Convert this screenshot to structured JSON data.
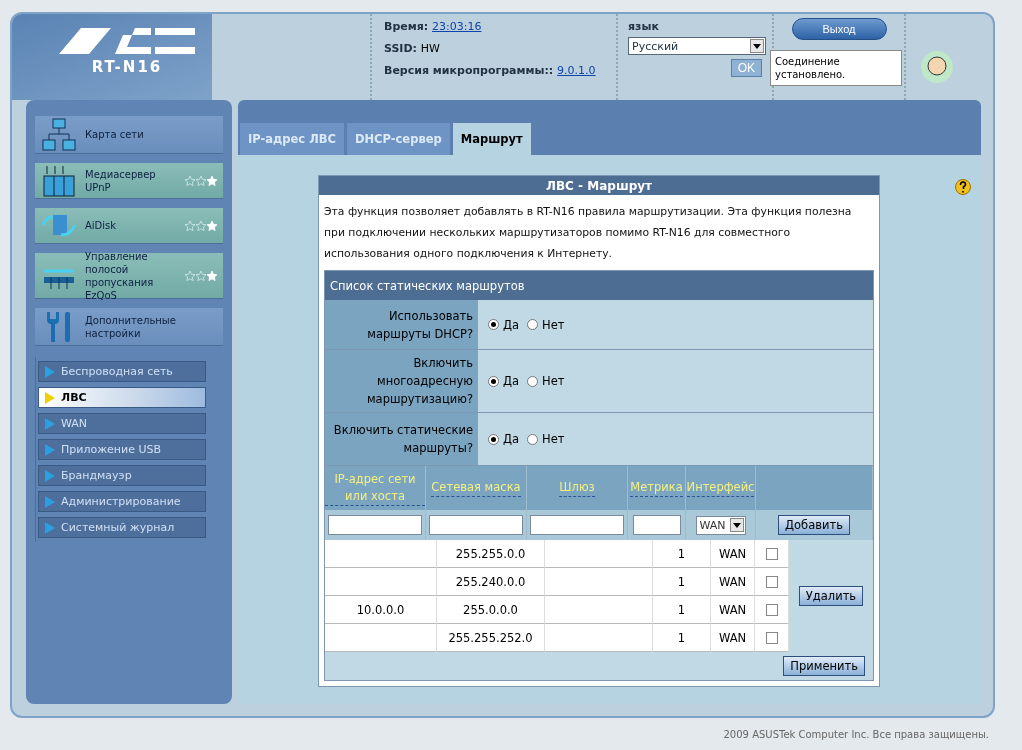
{
  "header": {
    "model": "RT-N16",
    "time_label": "Время:",
    "time": "23:03:16",
    "ssid_label": "SSID:",
    "ssid": "HW",
    "firmware_label": "Версия микропрограммы::",
    "firmware": "9.0.1.0",
    "language_label": "язык",
    "language": "Русский",
    "ok_button": "OK",
    "logout_button": "Выход",
    "status": "Соединение установлено."
  },
  "sidebar": {
    "items": [
      {
        "label": "Карта сети",
        "highlight": false
      },
      {
        "label": "Медиасервер UPnP",
        "highlight": true,
        "stars": 1
      },
      {
        "label": "AiDisk",
        "highlight": true,
        "stars": 1
      },
      {
        "label": "Управление полосой пропускания EzQoS",
        "highlight": true,
        "stars": 1
      },
      {
        "label": "Дополнительные настройки",
        "highlight": false
      }
    ],
    "subitems": [
      {
        "label": "Беспроводная сеть",
        "selected": false
      },
      {
        "label": "ЛВС",
        "selected": true
      },
      {
        "label": "WAN",
        "selected": false
      },
      {
        "label": "Приложение USB",
        "selected": false
      },
      {
        "label": "Брандмауэр",
        "selected": false
      },
      {
        "label": "Администрирование",
        "selected": false
      },
      {
        "label": "Системный журнал",
        "selected": false
      }
    ]
  },
  "tabs": [
    {
      "label": "IP-адрес ЛВС",
      "selected": false
    },
    {
      "label": "DHCP-сервер",
      "selected": false
    },
    {
      "label": "Маршрут",
      "selected": true
    }
  ],
  "form": {
    "title": "ЛВС - Маршрут",
    "description": "Эта функция позволяет добавлять в RT-N16 правила маршрутизации. Эта функция полезна при подключении нескольких маршрутизаторов помимо RT-N16 для совместного использования одного подключения к Интернету.",
    "section": "Список статических маршрутов",
    "options": [
      {
        "label": "Использовать маршруты DHCP?",
        "yes": "Да",
        "no": "Нет",
        "value": true
      },
      {
        "label": "Включить многоадресную маршрутизацию?",
        "yes": "Да",
        "no": "Нет",
        "value": true
      },
      {
        "label": "Включить статические маршруты?",
        "yes": "Да",
        "no": "Нет",
        "value": true
      }
    ],
    "columns": [
      "IP-адрес сети или хоста",
      "Сетевая маска",
      "Шлюз",
      "Метрика",
      "Интерфейс"
    ],
    "interface_select": "WAN",
    "add_button": "Добавить",
    "delete_button": "Удалить",
    "apply_button": "Применить",
    "rows": [
      {
        "mask": "255.255.0.0",
        "metric": "1",
        "interface": "WAN",
        "checked": false
      },
      {
        "mask": "255.240.0.0",
        "metric": "1",
        "interface": "WAN",
        "checked": false
      },
      {
        "ip": "10.0.0.0",
        "mask": "255.0.0.0",
        "metric": "1",
        "interface": "WAN",
        "checked": false
      },
      {
        "mask": "255.255.252.0",
        "metric": "1",
        "interface": "WAN",
        "checked": false
      }
    ]
  },
  "footer": "2009 ASUSTek Computer Inc. Все права защищены."
}
